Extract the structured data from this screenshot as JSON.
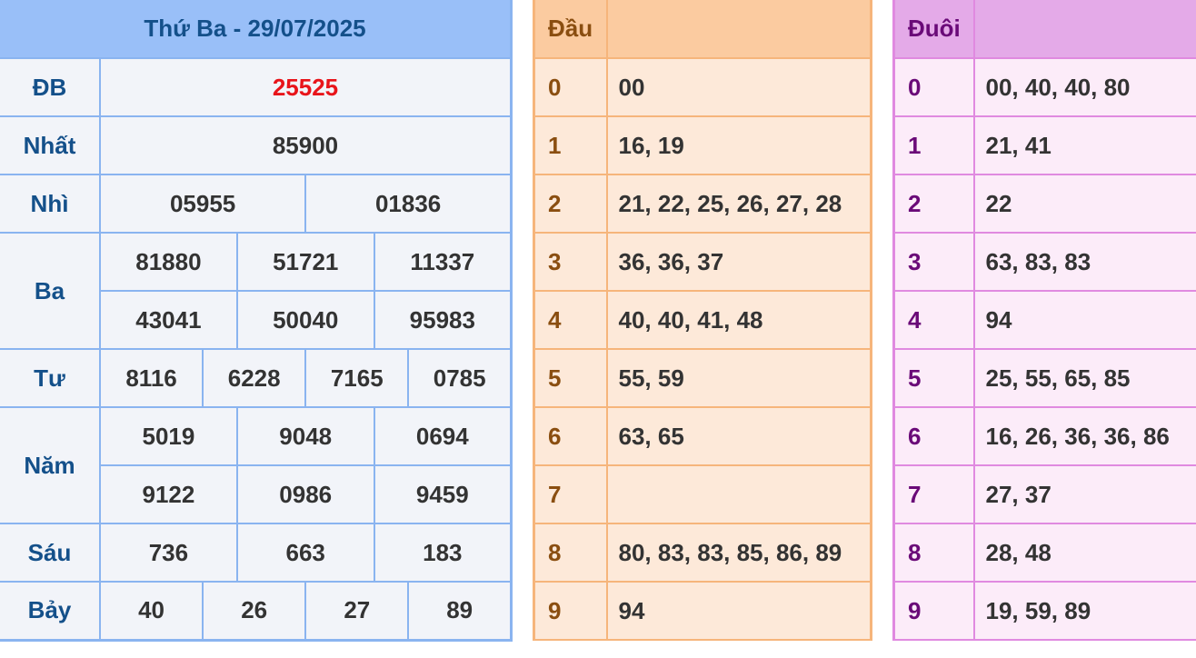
{
  "results": {
    "title": "Thứ Ba - 29/07/2025",
    "prizes": {
      "db": {
        "label": "ĐB",
        "values": [
          "25525"
        ]
      },
      "nhat": {
        "label": "Nhất",
        "values": [
          "85900"
        ]
      },
      "nhi": {
        "label": "Nhì",
        "values": [
          "05955",
          "01836"
        ]
      },
      "ba": {
        "label": "Ba",
        "values": [
          "81880",
          "51721",
          "11337",
          "43041",
          "50040",
          "95983"
        ]
      },
      "tu": {
        "label": "Tư",
        "values": [
          "8116",
          "6228",
          "7165",
          "0785"
        ]
      },
      "nam": {
        "label": "Năm",
        "values": [
          "5019",
          "9048",
          "0694",
          "9122",
          "0986",
          "9459"
        ]
      },
      "sau": {
        "label": "Sáu",
        "values": [
          "736",
          "663",
          "183"
        ]
      },
      "bay": {
        "label": "Bảy",
        "values": [
          "40",
          "26",
          "27",
          "89"
        ]
      }
    },
    "colors": {
      "special": "#e8141a",
      "label": "#14508a",
      "header_bg": "#99bff8",
      "border": "#8ab4f0"
    }
  },
  "dau": {
    "header": "Đầu",
    "header_value": "",
    "rows": [
      {
        "digit": "0",
        "values": "00"
      },
      {
        "digit": "1",
        "values": "16, 19"
      },
      {
        "digit": "2",
        "values": "21, 22, 25, 26, 27, 28"
      },
      {
        "digit": "3",
        "values": "36, 36, 37"
      },
      {
        "digit": "4",
        "values": "40, 40, 41, 48"
      },
      {
        "digit": "5",
        "values": "55, 59"
      },
      {
        "digit": "6",
        "values": "63, 65"
      },
      {
        "digit": "7",
        "values": ""
      },
      {
        "digit": "8",
        "values": "80, 83, 83, 85, 86, 89"
      },
      {
        "digit": "9",
        "values": "94"
      }
    ]
  },
  "duoi": {
    "header": "Đuôi",
    "header_value": "",
    "rows": [
      {
        "digit": "0",
        "values": "00, 40, 40, 80"
      },
      {
        "digit": "1",
        "values": "21, 41"
      },
      {
        "digit": "2",
        "values": "22"
      },
      {
        "digit": "3",
        "values": "63, 83, 83"
      },
      {
        "digit": "4",
        "values": "94"
      },
      {
        "digit": "5",
        "values": "25, 55, 65, 85"
      },
      {
        "digit": "6",
        "values": "16, 26, 36, 36, 86"
      },
      {
        "digit": "7",
        "values": "27, 37"
      },
      {
        "digit": "8",
        "values": "28, 48"
      },
      {
        "digit": "9",
        "values": "19, 59, 89"
      }
    ]
  }
}
